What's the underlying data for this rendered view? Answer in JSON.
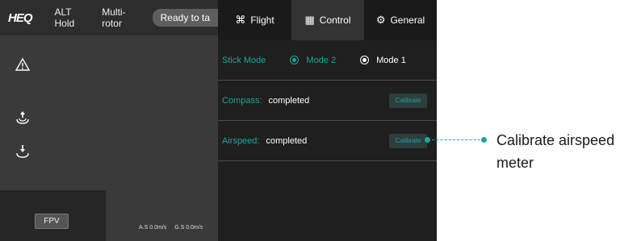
{
  "topbar": {
    "logo": "HEQ",
    "flight_mode": "ALT Hold",
    "vehicle": "Multi-rotor",
    "status": "Ready to ta"
  },
  "sidebar_icons": [
    "warning-icon",
    "takeoff-icon",
    "landing-icon"
  ],
  "fpv": {
    "label": "FPV"
  },
  "speeds": {
    "as": "A.S 0.0m/s",
    "gs": "G.S 0.0m/s"
  },
  "tabs": [
    {
      "label": "Flight",
      "icon": "drone-icon"
    },
    {
      "label": "Control",
      "icon": "controller-icon",
      "active": true
    },
    {
      "label": "General",
      "icon": "gear-icon"
    }
  ],
  "stick_mode": {
    "label": "Stick Mode",
    "options": [
      {
        "label": "Mode 2",
        "selected": true
      },
      {
        "label": "Mode 1",
        "selected": false
      }
    ]
  },
  "compass": {
    "label": "Compass:",
    "value": "completed",
    "button": "Calibrate"
  },
  "airspeed": {
    "label": "Airspeed:",
    "value": "completed",
    "button": "Calibrate"
  },
  "callout": {
    "text": "Calibrate airspeed meter"
  },
  "colors": {
    "accent": "#1aa6a0",
    "panel": "#1f1f1f",
    "background": "#3a3a3a"
  }
}
